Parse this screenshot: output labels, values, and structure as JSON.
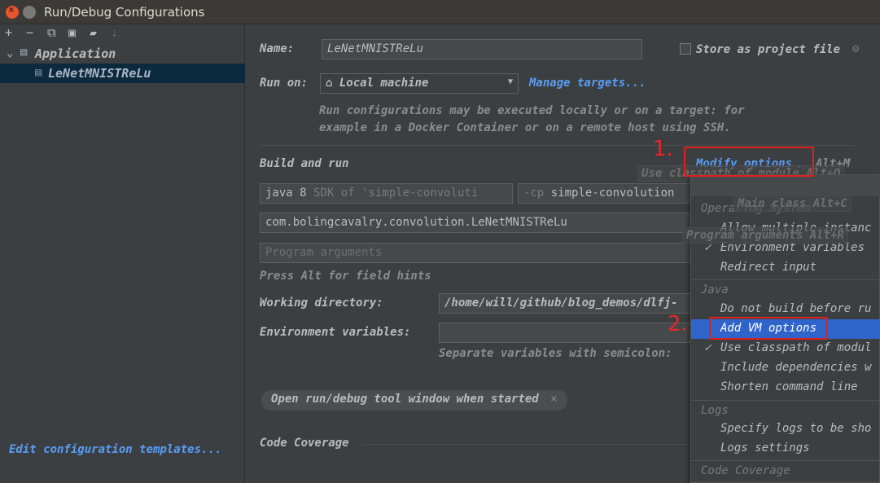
{
  "window": {
    "title": "Run/Debug Configurations"
  },
  "sidebar": {
    "tree": [
      {
        "label": "Application",
        "children": [
          {
            "label": "LeNetMNISTReLu",
            "selected": true
          }
        ]
      }
    ],
    "footer_link": "Edit configuration templates..."
  },
  "form": {
    "name_label": "Name:",
    "name_value": "LeNetMNISTReLu",
    "store_label": "Store as project file",
    "run_on_label": "Run on:",
    "run_on_value": "Local machine",
    "manage_targets": "Manage targets...",
    "run_on_hint_1": "Run configurations may be executed locally or on a target: for",
    "run_on_hint_2": "example in a Docker Container or on a remote host using SSH.",
    "build_run": "Build and run",
    "modify_options": "Modify options",
    "modify_shortcut": "Alt+M",
    "jre_main": "java 8",
    "jre_rest": "SDK of 'simple-convoluti",
    "cp_prefix": "-cp",
    "cp_value": "simple-convolution",
    "main_class": "com.bolingcavalry.convolution.LeNetMNISTReLu",
    "program_args_placeholder": "Program arguments",
    "alt_hint": "Press Alt for field hints",
    "working_dir_label": "Working directory:",
    "working_dir_value": "/home/will/github/blog_demos/dlfj-",
    "env_label": "Environment variables:",
    "env_value": "",
    "env_hint": "Separate variables with semicolon:",
    "tag_open_tool": "Open run/debug tool window when started",
    "code_coverage": "Code Coverage"
  },
  "ghost_hints": {
    "classpath": "Use classpath of module Alt+O",
    "main_class": "Main class Alt+C",
    "program_args": "Program arguments Alt+R"
  },
  "popup": {
    "sections": [
      {
        "header": "Operating System",
        "items": [
          {
            "label": "Allow multiple instanc",
            "checked": false
          },
          {
            "label": "Environment variables",
            "checked": true
          },
          {
            "label": "Redirect input",
            "checked": false
          }
        ]
      },
      {
        "header": "Java",
        "items": [
          {
            "label": "Do not build before ru",
            "checked": false
          },
          {
            "label": "Add VM options",
            "checked": false,
            "highlighted": true
          },
          {
            "label": "Use classpath of modul",
            "checked": true
          },
          {
            "label": "Include dependencies w",
            "checked": false
          },
          {
            "label": "Shorten command line",
            "checked": false
          }
        ]
      },
      {
        "header": "Logs",
        "items": [
          {
            "label": "Specify logs to be sho",
            "checked": false
          },
          {
            "label": "Logs settings",
            "checked": false
          }
        ]
      },
      {
        "header": "Code Coverage",
        "items": []
      }
    ]
  },
  "annotations": {
    "step1": "1.",
    "step2": "2."
  },
  "colors": {
    "background": "#3c3f41",
    "selection": "#0d293e",
    "highlight": "#2f65ca",
    "link": "#589df6",
    "annotation": "#e0201c"
  }
}
